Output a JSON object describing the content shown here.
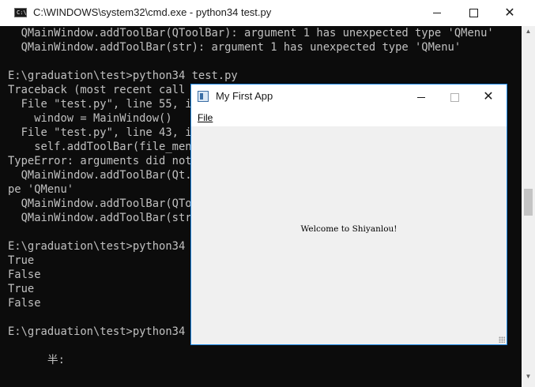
{
  "cmd": {
    "title": "C:\\WINDOWS\\system32\\cmd.exe - python34  test.py",
    "icon": "console-icon",
    "lines": [
      "  QMainWindow.addToolBar(QToolBar): argument 1 has unexpected type 'QMenu'",
      "  QMainWindow.addToolBar(str): argument 1 has unexpected type 'QMenu'",
      "",
      "E:\\graduation\\test>python34 test.py",
      "Traceback (most recent call l",
      "  File \"test.py\", line 55, in",
      "    window = MainWindow()",
      "  File \"test.py\", line 43, in",
      "    self.addToolBar(file_menu",
      "TypeError: arguments did not",
      "  QMainWindow.addToolBar(Qt.T                                         y",
      "pe 'QMenu'",
      "  QMainWindow.addToolBar(QTo",
      "  QMainWindow.addToolBar(str)",
      "",
      "E:\\graduation\\test>python34 t",
      "True",
      "False",
      "True",
      "False",
      "",
      "E:\\graduation\\test>python34 t",
      "",
      "      半:"
    ]
  },
  "app": {
    "title": "My First App",
    "menu": [
      "File"
    ],
    "welcome": "Welcome to Shiyanlou!"
  },
  "colors": {
    "console_bg": "#0c0c0c",
    "console_text": "#c0c0c0",
    "app_border": "#1e88e5",
    "app_central_bg": "#f0f0f0"
  }
}
